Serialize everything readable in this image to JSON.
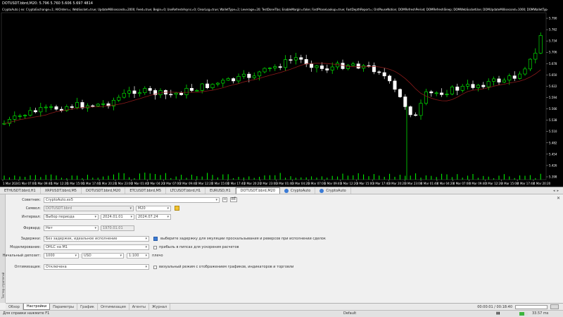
{
  "chart": {
    "title": "DOTUSDT.bbrd,M20: 5.796 5.760 5.606 5.697 4814",
    "params": "CryptoAuto | ex: CryptoExchange=1; AllOrders=; WebSocket=true; UpdateMilliseconds=2000; Feed=true; Begin=0; UseRefreshAsync=0; ClearLog=true; WalletType=2; Leverage=20; TestDoneTbo; EnableMargin=false; FastPhaseLookup=true; FastDepthReport=; OrdPauseNotion; DOMRefreshPeriod; DOMRefreshSleep; DOMWebSocketUse; DOMUpdateMillisecond=1000; DOMWalletType=2; DOMLeverage=20",
    "price_labels": [
      "5.790",
      "5.762",
      "5.734",
      "5.706",
      "5.678",
      "5.650",
      "5.622",
      "5.594",
      "5.566",
      "5.538",
      "5.510",
      "5.482",
      "5.454",
      "5.426",
      "5.398"
    ],
    "time_labels": [
      "1 Mar 2024",
      "1 Mar 07:00",
      "1 Mar 09:40",
      "1 Mar 12:20",
      "1 Mar 15:00",
      "1 Mar 17:40",
      "1 Mar 20:20",
      "1 Mar 23:00",
      "2 Mar 01:40",
      "2 Mar 04:20",
      "2 Mar 07:00",
      "2 Mar 09:40",
      "2 Mar 12:20",
      "2 Mar 15:00",
      "2 Mar 17:40",
      "2 Mar 20:20",
      "2 Mar 23:00",
      "3 Mar 01:40",
      "3 Mar 04:20",
      "3 Mar 07:00",
      "3 Mar 09:40",
      "3 Mar 12:20",
      "3 Mar 15:00",
      "3 Mar 17:40",
      "3 Mar 20:20",
      "3 Mar 23:00",
      "4 Mar 01:40",
      "4 Mar 04:20",
      "4 Mar 07:00",
      "4 Mar 09:40",
      "4 Mar 12:20",
      "4 Mar 15:00",
      "4 Mar 17:40",
      "4 Mar 20:20"
    ],
    "colors": {
      "background": "#000000",
      "bull": "#00ff00",
      "bear": "#ffffff",
      "ma": "#8b1a1a"
    }
  },
  "chart_tabs": [
    {
      "label": "ETHUSDT.bbrd,H1",
      "active": false,
      "icon": false
    },
    {
      "label": "XRPUSDT.bbrd,M5",
      "active": false,
      "icon": false
    },
    {
      "label": "DOTUSDT.bbrd,M20",
      "active": false,
      "icon": false
    },
    {
      "label": "ETCUSDT.bbrd,M5",
      "active": false,
      "icon": false
    },
    {
      "label": "LTCUSDT.bbrd,H1",
      "active": false,
      "icon": false
    },
    {
      "label": "EURUSD,H1",
      "active": false,
      "icon": false
    },
    {
      "label": "DOTUSDT.bbrd,M20",
      "active": true,
      "icon": false
    },
    {
      "label": "CryptoAuto",
      "active": false,
      "icon": true
    },
    {
      "label": "CryptoAuto",
      "active": false,
      "icon": true
    }
  ],
  "tester": {
    "side_label": "Тестер стратегий",
    "close": "✕",
    "advisor_label": "Советник:",
    "advisor_value": "CryptoAuto.ex5",
    "advisor_btn1": "⇔",
    "advisor_btn2": "ЕЁ",
    "symbol_label": "Символ:",
    "symbol_value": "DOTUSDT.bbrd",
    "timeframe_value": "M20",
    "interval_label": "Интервал:",
    "interval_value": "Выбор периода",
    "date_from": "2024.01.01",
    "date_to": "2024.07.24",
    "forward_label": "Форвард:",
    "forward_value": "Нет",
    "forward_date": "1970.01.01",
    "delays_label": "Задержки:",
    "delays_value": "Без задержек, идеальное исполнение",
    "delays_hint": "выберите задержку для эмуляции проскальзывания и реверсов при исполнении сделок",
    "model_label": "Моделирование:",
    "model_value": "OHLC на M1",
    "model_hint": "прибыль в пипсах для ускорения расчетов",
    "deposit_label": "Начальный депозит:",
    "deposit_value": "1000",
    "currency_value": "USD",
    "leverage_value": "1:100",
    "leverage_text": "плечо",
    "optimization_label": "Оптимизация:",
    "optimization_value": "Отключена",
    "visual_hint": "визуальный режим с отображением графиков, индикаторов и торговли"
  },
  "bottom_tabs": [
    {
      "label": "Обзор",
      "active": false
    },
    {
      "label": "Настройки",
      "active": true
    },
    {
      "label": "Параметры",
      "active": false
    },
    {
      "label": "График",
      "active": false
    },
    {
      "label": "Оптимизация",
      "active": false
    },
    {
      "label": "Агенты",
      "active": false
    },
    {
      "label": "Журнал",
      "active": false
    }
  ],
  "timer": {
    "elapsed": "00:00:01 / 00:18:40",
    "progress": 0.0
  },
  "status": {
    "help": "Для справки нажмите F1",
    "profile": "Default",
    "signal": "33.57 ms",
    "ping": "33.57 ms"
  }
}
